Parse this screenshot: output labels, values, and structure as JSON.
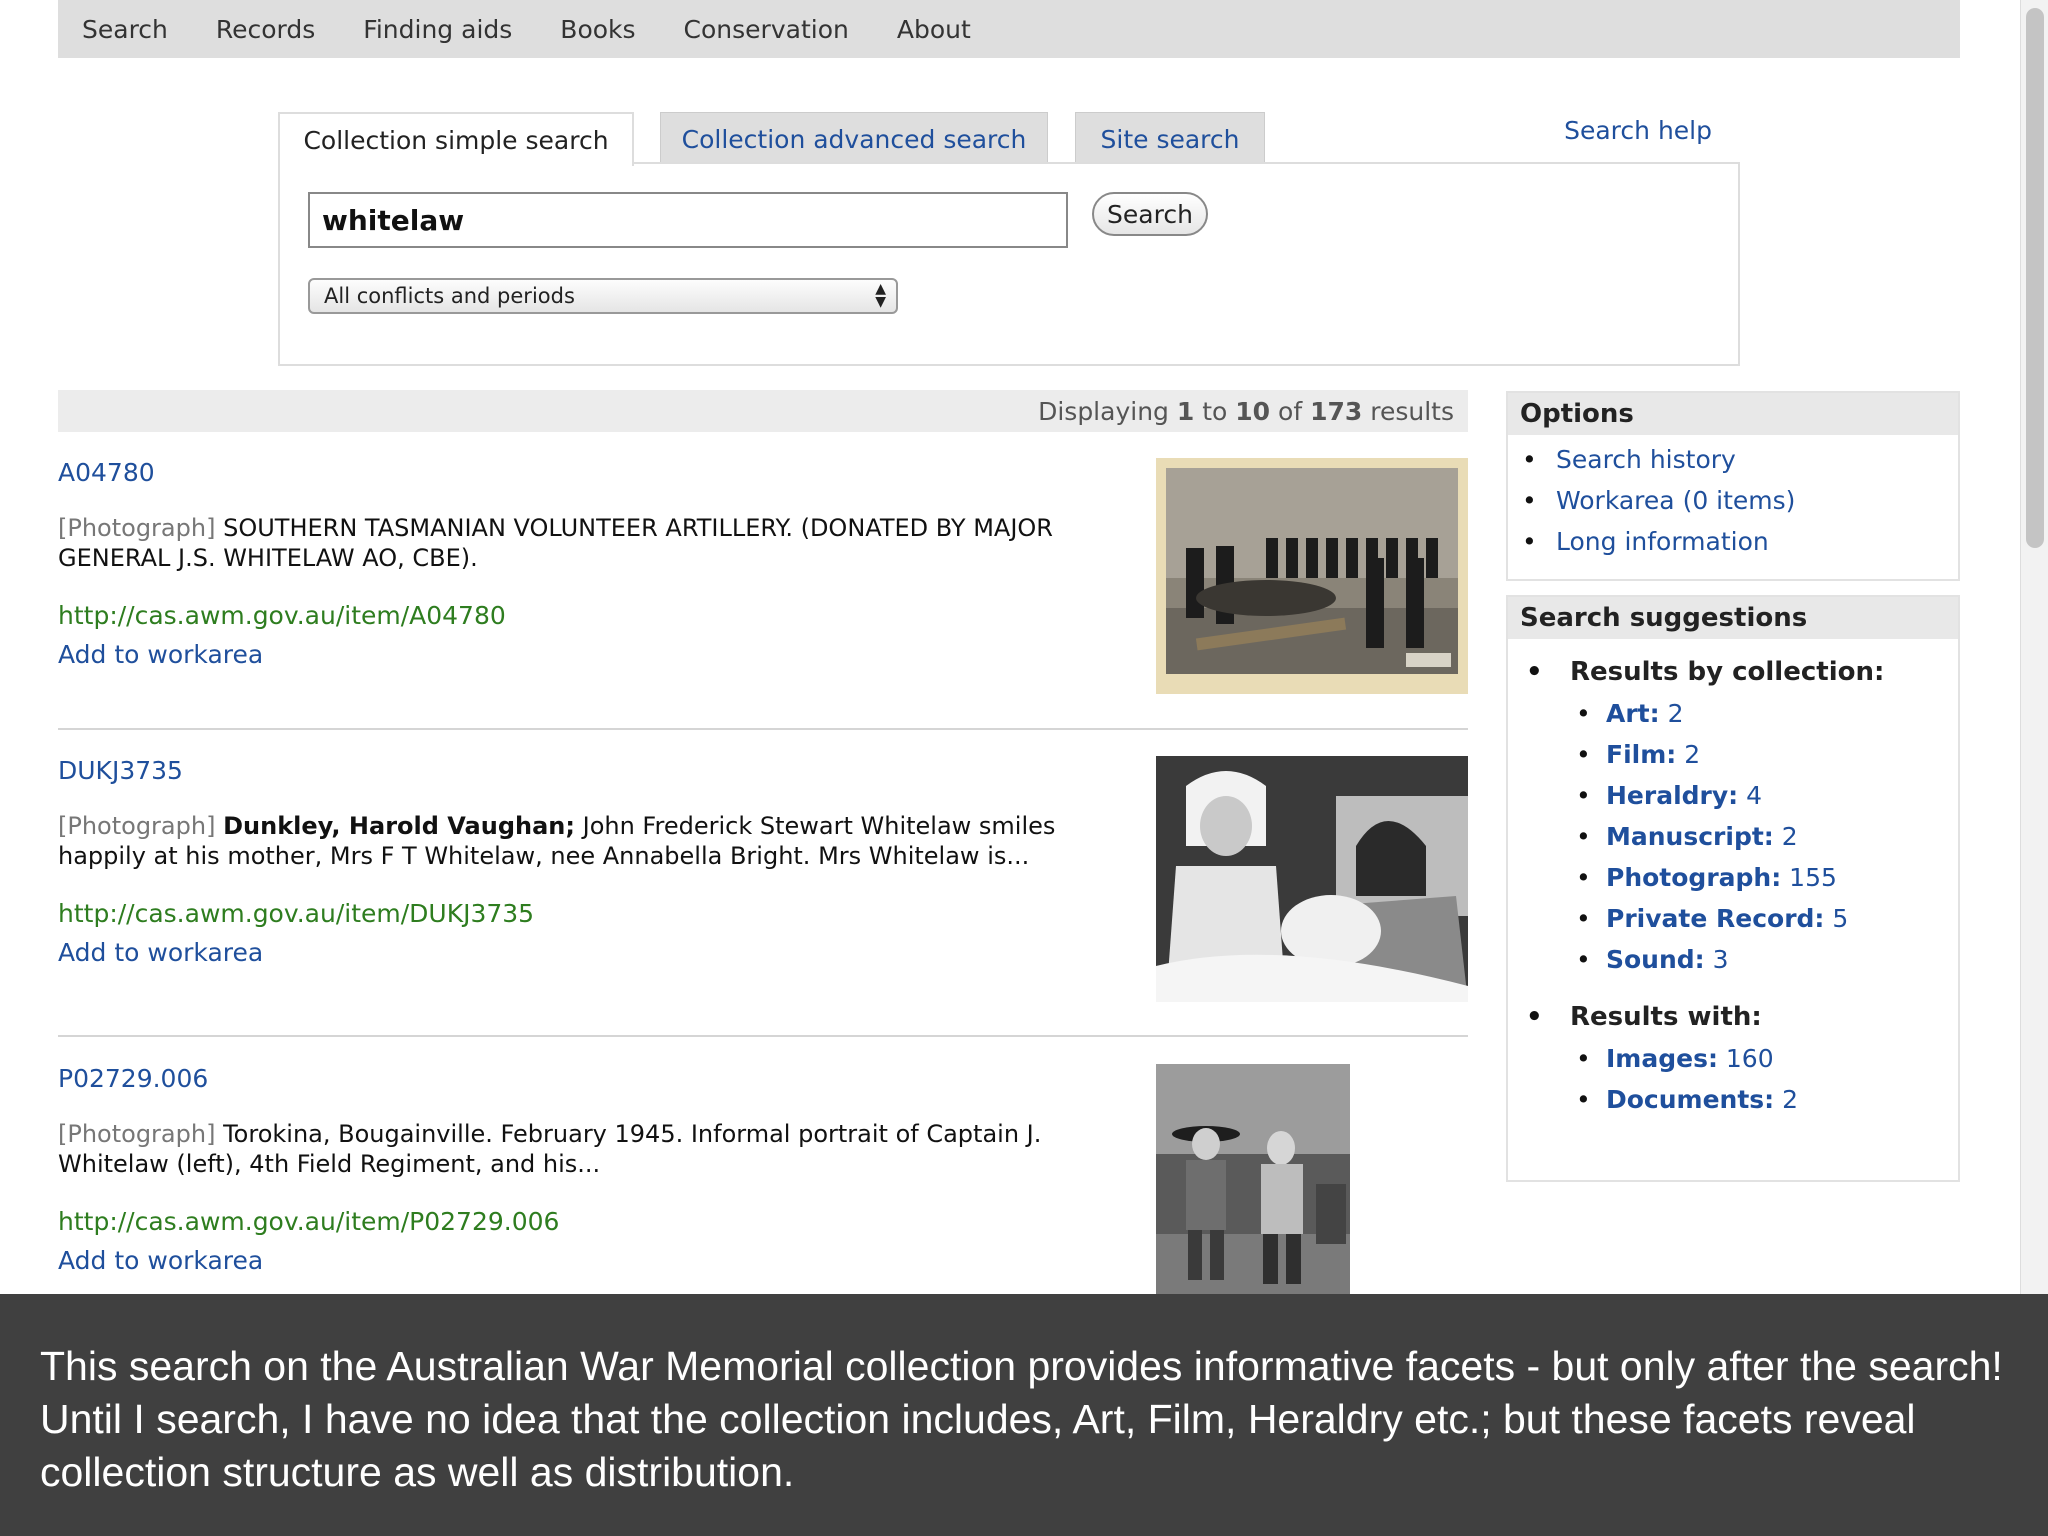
{
  "nav": [
    "Search",
    "Records",
    "Finding aids",
    "Books",
    "Conservation",
    "About"
  ],
  "tabs": {
    "simple": "Collection simple search",
    "advanced": "Collection advanced search",
    "site": "Site search",
    "help": "Search help"
  },
  "search": {
    "value": "whitelaw",
    "button": "Search",
    "select_value": "All conflicts and periods"
  },
  "results_header": {
    "prefix": "Displaying",
    "from": "1",
    "to_word": "to",
    "to": "10",
    "of_word": "of",
    "total": "173",
    "suffix": "results"
  },
  "results": [
    {
      "id": "A04780",
      "type": "[Photograph]",
      "bold": "",
      "text": "SOUTHERN TASMANIAN VOLUNTEER ARTILLERY. (DONATED BY MAJOR GENERAL J.S. WHITELAW AO, CBE).",
      "url": "http://cas.awm.gov.au/item/A04780",
      "add": "Add to workarea"
    },
    {
      "id": "DUKJ3735",
      "type": "[Photograph]",
      "bold": "Dunkley, Harold Vaughan;",
      "text": "John Frederick Stewart Whitelaw smiles happily at his mother, Mrs F T Whitelaw, nee Annabella Bright. Mrs Whitelaw is...",
      "url": "http://cas.awm.gov.au/item/DUKJ3735",
      "add": "Add to workarea"
    },
    {
      "id": "P02729.006",
      "type": "[Photograph]",
      "bold": "",
      "text": "Torokina, Bougainville. February 1945. Informal portrait of Captain J. Whitelaw (left), 4th Field Regiment, and his...",
      "url": "http://cas.awm.gov.au/item/P02729.006",
      "add": "Add to workarea"
    }
  ],
  "options": {
    "title": "Options",
    "items": [
      "Search history",
      "Workarea (0 items)",
      "Long information"
    ]
  },
  "suggestions": {
    "title": "Search suggestions",
    "by_collection_label": "Results by collection:",
    "by_collection": [
      {
        "name": "Art:",
        "count": "2"
      },
      {
        "name": "Film:",
        "count": "2"
      },
      {
        "name": "Heraldry:",
        "count": "4"
      },
      {
        "name": "Manuscript:",
        "count": "2"
      },
      {
        "name": "Photograph:",
        "count": "155"
      },
      {
        "name": "Private Record:",
        "count": "5"
      },
      {
        "name": "Sound:",
        "count": "3"
      }
    ],
    "with_label": "Results with:",
    "with": [
      {
        "name": "Images:",
        "count": "160"
      },
      {
        "name": "Documents:",
        "count": "2"
      }
    ]
  },
  "caption": "This search on the Australian War Memorial collection provides informative facets - but only after the search! Until I search, I have no idea that the collection includes, Art, Film, Heraldry etc.; but these facets reveal collection structure as well as distribution."
}
